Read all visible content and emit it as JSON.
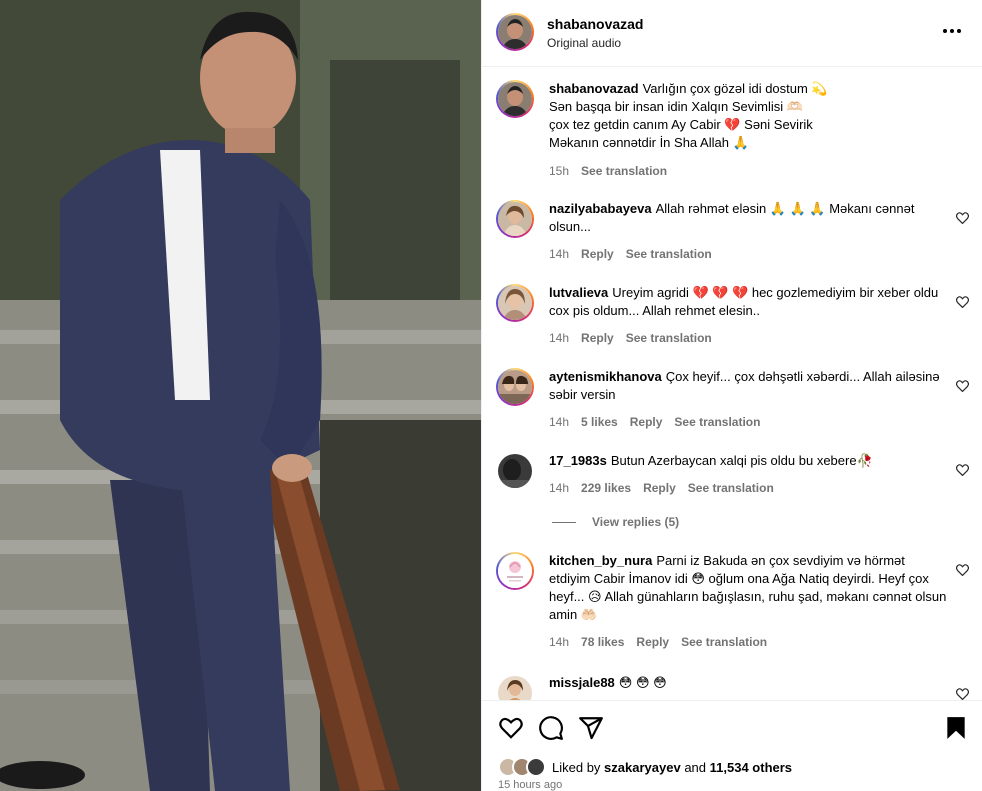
{
  "post": {
    "username": "shabanovazad",
    "audio": "Original audio"
  },
  "caption": {
    "username": "shabanovazad",
    "lines": [
      "Varlığın çox gözəl idi dostum 💫",
      "Sən başqa bir insan idin Xalqın Sevimlisi 🫶🏻",
      "çox tez getdin canım Ay Cabir 💔  Səni Sevirik",
      "Məkanın cənnətdir İn Sha Allah 🙏"
    ],
    "time": "15h",
    "translation": "See translation"
  },
  "comments": [
    {
      "username": "nazilyababayeva",
      "text": "Allah rəhmət eləsin 🙏 🙏 🙏  Məkanı cənnət olsun...",
      "time": "14h",
      "likes": "",
      "reply": "Reply",
      "translation": "See translation"
    },
    {
      "username": "lutvalieva",
      "text": "Ureyim agridi 💔 💔 💔  hec gozlemediyim bir xeber oldu cox pis oldum... Allah rehmet elesin..",
      "time": "14h",
      "likes": "",
      "reply": "Reply",
      "translation": "See translation"
    },
    {
      "username": "aytenismikhanova",
      "text": "Çox heyif... çox dəhşətli xəbərdi... Allah ailəsinə səbir versin",
      "time": "14h",
      "likes": "5 likes",
      "reply": "Reply",
      "translation": "See translation"
    },
    {
      "username": "17_1983s",
      "text": "Butun Azerbaycan xalqi pis oldu bu xebere🥀",
      "time": "14h",
      "likes": "229 likes",
      "reply": "Reply",
      "translation": "See translation",
      "view_replies": "View replies (5)"
    },
    {
      "username": "kitchen_by_nura",
      "text": "Parni iz Bakuda ən çox sevdiyim və hörmət etdiyim Cabir İmanov idi 😳 oğlum ona Ağa Natiq deyirdi. Heyf çox heyf...  😥  Allah günahların bağışlasın, ruhu şad, məkanı cənnət olsun amin 🤲🏻",
      "time": "14h",
      "likes": "78 likes",
      "reply": "Reply",
      "translation": "See translation"
    },
    {
      "username": "missjale88",
      "text": "😳 😳 😳",
      "time": "",
      "likes": "",
      "reply": "",
      "translation": ""
    }
  ],
  "likes": {
    "prefix": "Liked by",
    "user": "szakaryayev",
    "middle": "and",
    "others": "11,534 others"
  },
  "time_ago": "15 hours ago",
  "icons": {
    "more": "more-options-icon",
    "like": "heart-icon",
    "comment": "comment-icon",
    "share": "share-icon",
    "save": "bookmark-icon",
    "comment_like": "heart-outline-icon"
  },
  "colors": {
    "meta_gray": "#737373",
    "border": "#efefef"
  }
}
